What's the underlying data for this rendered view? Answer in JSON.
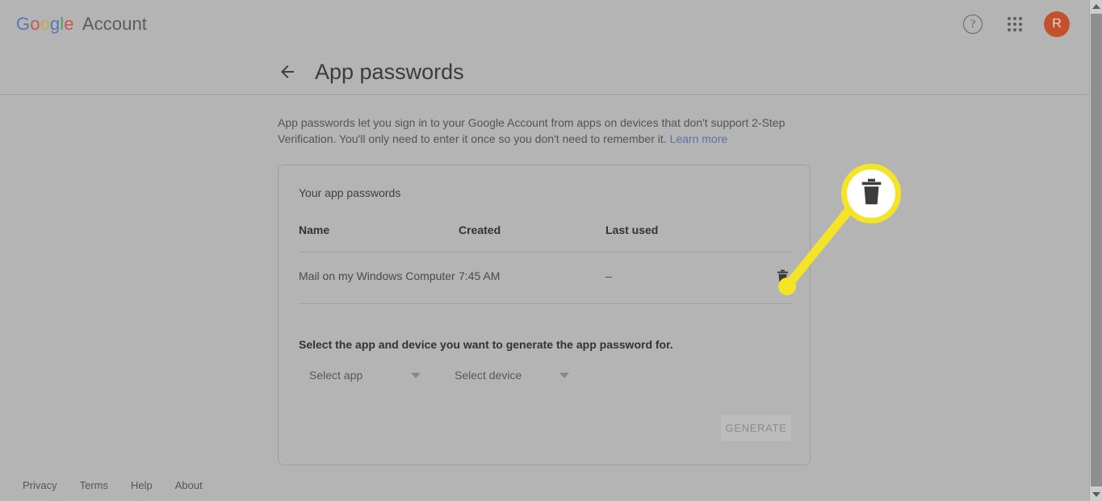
{
  "brand": {
    "google_letters": [
      {
        "char": "G",
        "color": "#5779b8"
      },
      {
        "char": "o",
        "color": "#c6584f"
      },
      {
        "char": "o",
        "color": "#c7a84b"
      },
      {
        "char": "g",
        "color": "#5779b8"
      },
      {
        "char": "l",
        "color": "#5a9a6a"
      },
      {
        "char": "e",
        "color": "#c6584f"
      }
    ],
    "account_label": "Account"
  },
  "topbar": {
    "help_icon": "help-circle-icon",
    "apps_icon": "apps-grid-icon",
    "avatar_initial": "R",
    "avatar_color": "#c4502c"
  },
  "header": {
    "back_icon": "back-arrow-icon",
    "title": "App passwords"
  },
  "description": {
    "text_before_link": "App passwords let you sign in to your Google Account from apps on devices that don't support 2-Step Verification. You'll only need to enter it once so you don't need to remember it. ",
    "link_label": "Learn more",
    "link_color": "#5973a8"
  },
  "card": {
    "title": "Your app passwords",
    "table": {
      "columns": [
        "Name",
        "Created",
        "Last used",
        ""
      ],
      "rows": [
        {
          "name": "Mail on my Windows Computer",
          "created": "7:45 AM",
          "last_used": "–",
          "action_icon": "trash-icon"
        }
      ]
    },
    "generate_section": {
      "label": "Select the app and device you want to generate the app password for.",
      "select_app": {
        "value": "Select app",
        "caret_icon": "chevron-down-icon"
      },
      "select_device": {
        "value": "Select device",
        "caret_icon": "chevron-down-icon"
      },
      "generate_button": "GENERATE"
    }
  },
  "annotation": {
    "callout_icon": "trash-icon",
    "highlight_color": "#f5e425",
    "bubble_fill": "#ffffff"
  },
  "footer": {
    "links": [
      "Privacy",
      "Terms",
      "Help",
      "About"
    ]
  },
  "scrollbar": {
    "up_icon": "scroll-up-arrow-icon",
    "down_icon": "scroll-down-arrow-icon"
  }
}
